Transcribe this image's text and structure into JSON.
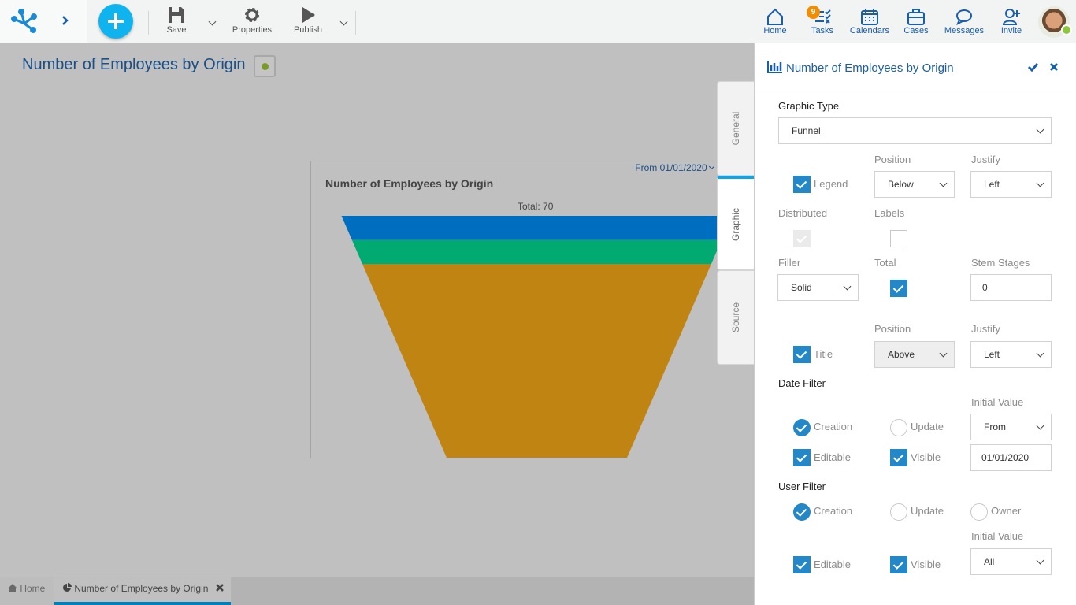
{
  "toolbar": {
    "save": "Save",
    "properties": "Properties",
    "publish": "Publish"
  },
  "nav": {
    "home": "Home",
    "tasks": "Tasks",
    "tasks_badge": "9",
    "calendars": "Calendars",
    "cases": "Cases",
    "messages": "Messages",
    "invite": "Invite"
  },
  "page": {
    "title": "Number of Employees by Origin"
  },
  "chart_data": {
    "type": "funnel",
    "title": "Number of Employees by Origin",
    "date_filter": "From 01/01/2020",
    "total_label": "Total: 70",
    "total": 70,
    "values": [
      7,
      7,
      56
    ],
    "colors": [
      "#006ebf",
      "#00aa70",
      "#c08412"
    ]
  },
  "tabs": {
    "general": "General",
    "graphic": "Graphic",
    "source": "Source"
  },
  "panel": {
    "title": "Number of Employees by Origin",
    "graphic_type_label": "Graphic Type",
    "graphic_type": "Funnel",
    "position_label": "Position",
    "justify_label": "Justify",
    "legend": "Legend",
    "legend_position": "Below",
    "legend_justify": "Left",
    "distributed": "Distributed",
    "labels": "Labels",
    "filler_label": "Filler",
    "filler": "Solid",
    "total": "Total",
    "stem_stages_label": "Stem Stages",
    "stem_stages": "0",
    "title_label": "Title",
    "title_position": "Above",
    "title_justify": "Left",
    "date_filter": "Date Filter",
    "initial_value": "Initial Value",
    "creation": "Creation",
    "update": "Update",
    "date_initial": "From",
    "editable": "Editable",
    "visible": "Visible",
    "date_value": "01/01/2020",
    "user_filter": "User Filter",
    "owner": "Owner",
    "user_initial": "All"
  },
  "bottom_tabs": {
    "home": "Home",
    "current": "Number of Employees by Origin"
  }
}
